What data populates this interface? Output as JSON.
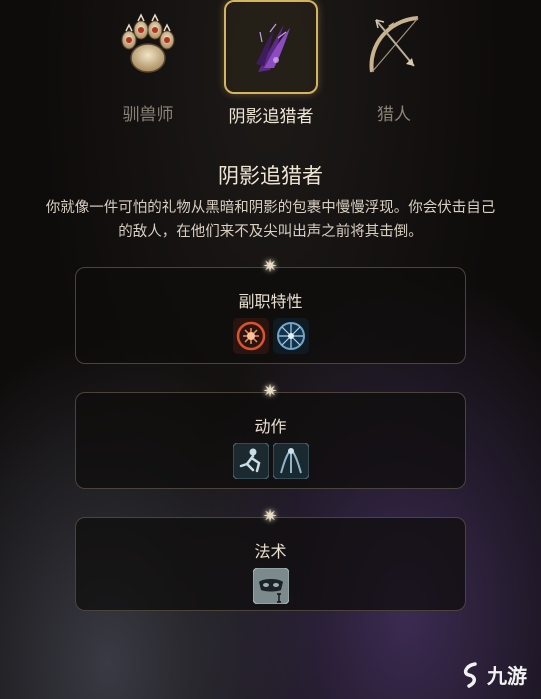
{
  "subclasses": [
    {
      "label": "驯兽师",
      "icon": "paw-icon",
      "selected": false
    },
    {
      "label": "阴影追猎者",
      "icon": "shadow-claw-icon",
      "selected": true
    },
    {
      "label": "猎人",
      "icon": "bow-icon",
      "selected": false
    }
  ],
  "detail": {
    "title": "阴影追猎者",
    "description": "你就像一件可怕的礼物从黑暗和阴影的包裹中慢慢浮现。你会伏击自己的敌人，在他们来不及尖叫出声之前将其击倒。"
  },
  "sections": [
    {
      "title": "副职特性",
      "icons": [
        "fire-sigil-icon",
        "dark-vision-icon"
      ]
    },
    {
      "title": "动作",
      "icons": [
        "ambush-figure-icon",
        "shadow-step-icon"
      ]
    },
    {
      "title": "法术",
      "icons": [
        "disguise-mask-icon"
      ]
    }
  ],
  "watermark": {
    "text": "九游"
  },
  "colors": {
    "gold": "#d6b35f",
    "text": "#efe6d6",
    "muted": "#8b8276"
  }
}
